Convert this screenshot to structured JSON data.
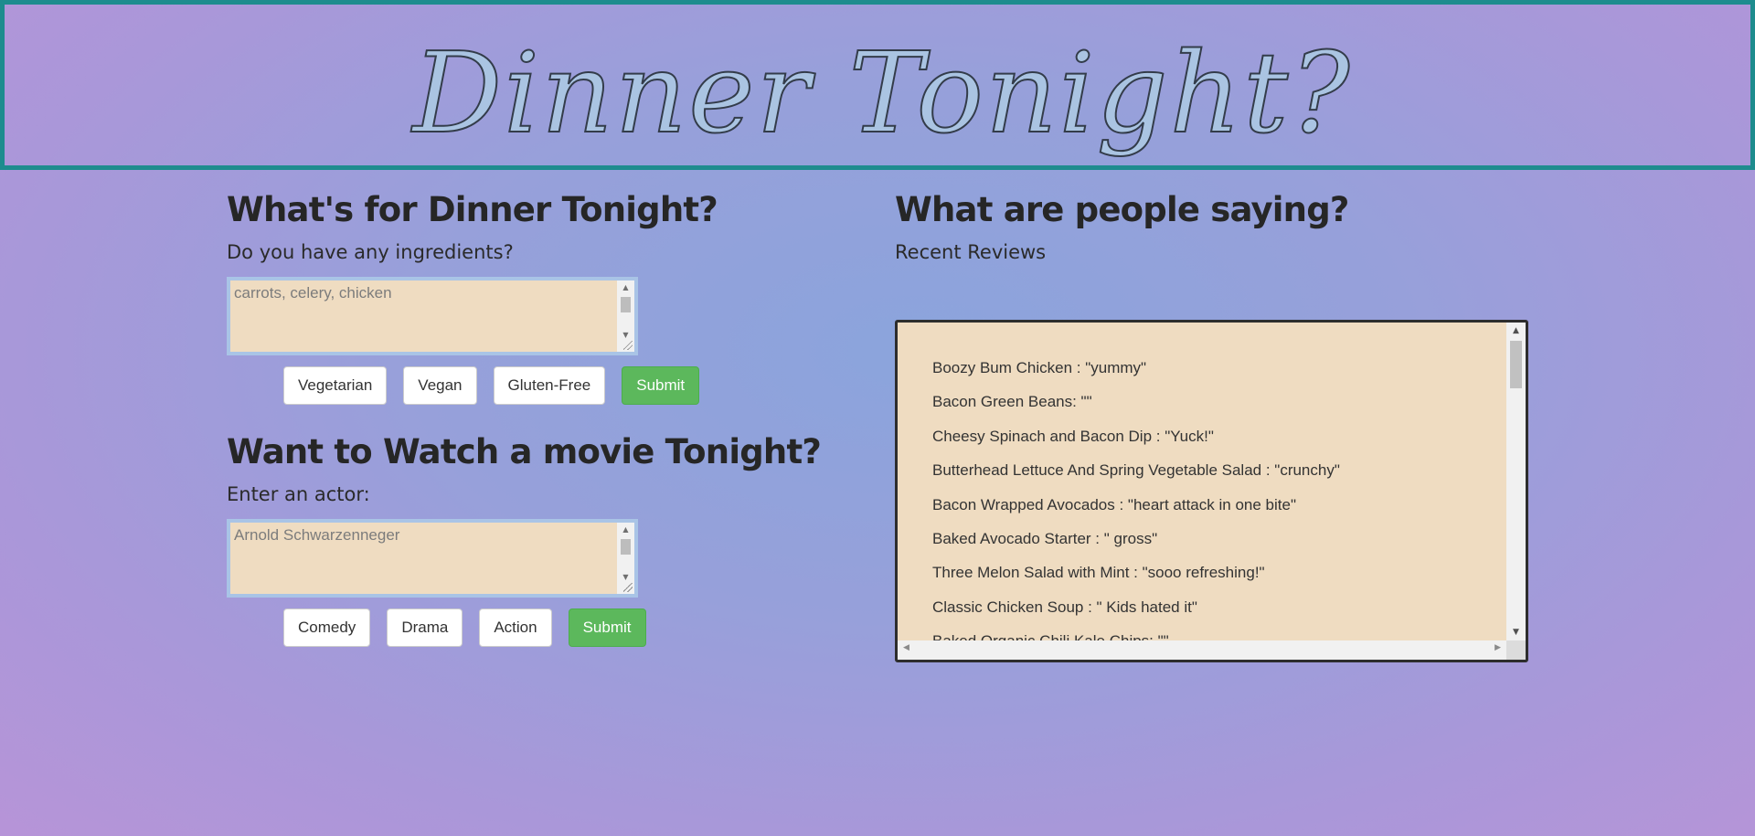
{
  "header": {
    "title": "Dinner Tonight?"
  },
  "dinner": {
    "heading": "What's for Dinner Tonight?",
    "prompt": "Do you have any ingredients?",
    "ingredients_placeholder": "carrots, celery, chicken",
    "buttons": [
      "Vegetarian",
      "Vegan",
      "Gluten-Free"
    ],
    "submit_label": "Submit"
  },
  "movie": {
    "heading": "Want to Watch a movie Tonight?",
    "prompt": "Enter an actor:",
    "actor_placeholder": "Arnold Schwarzenneger",
    "buttons": [
      "Comedy",
      "Drama",
      "Action"
    ],
    "submit_label": "Submit"
  },
  "reviews": {
    "heading": "What are people saying?",
    "subheading": "Recent Reviews",
    "items": [
      "Boozy Bum Chicken : \"yummy\"",
      "Bacon Green Beans: \"\"",
      "Cheesy Spinach and Bacon Dip : \"Yuck!\"",
      "Butterhead Lettuce And Spring Vegetable Salad : \"crunchy\"",
      "Bacon Wrapped Avocados : \"heart attack in one bite\"",
      "Baked Avocado Starter : \" gross\"",
      "Three Melon Salad with Mint : \"sooo refreshing!\"",
      "Classic Chicken Soup : \" Kids hated it\"",
      "Baked Organic Chili Kale Chips: \"\""
    ]
  },
  "colors": {
    "banner_border": "#1e8c8e",
    "title_fill": "#aac4e2",
    "textarea_bg": "#efdcc1",
    "submit_bg": "#5cb85c"
  },
  "icons": {
    "scroll_up": "▲",
    "scroll_down": "▼",
    "scroll_left": "◀",
    "scroll_right": "▶"
  }
}
